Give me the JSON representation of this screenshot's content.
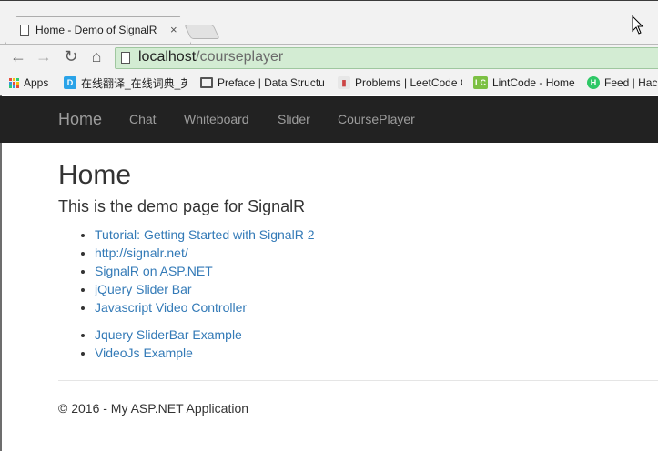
{
  "browser": {
    "tab_title": "Home - Demo of SignalR",
    "tab_close": "×",
    "url_host": "localhost",
    "url_path": "/courseplayer",
    "nav": {
      "back": "←",
      "forward": "→",
      "reload": "↻",
      "home": "⌂"
    },
    "bookmarks": [
      {
        "label": "Apps",
        "icon": "apps-grid-icon",
        "color": "#e74c3c"
      },
      {
        "label": "在线翻译_在线词典_英",
        "icon": "dict-icon",
        "color": "#2aa3e8",
        "glyph": "D"
      },
      {
        "label": "Preface | Data Structu",
        "icon": "book-icon",
        "color": "#555555"
      },
      {
        "label": "Problems | LeetCode O",
        "icon": "leetcode-icon",
        "color": "#c44"
      },
      {
        "label": "LintCode - Home",
        "icon": "lintcode-icon",
        "color": "#7cc043",
        "glyph": "LC"
      },
      {
        "label": "Feed | Hack",
        "icon": "hackerrank-icon",
        "color": "#2ec866",
        "glyph": "H"
      }
    ]
  },
  "navbar": {
    "brand": "Home",
    "links": [
      "Chat",
      "Whiteboard",
      "Slider",
      "CoursePlayer"
    ]
  },
  "main": {
    "title": "Home",
    "lead": "This is the demo page for SignalR",
    "links_group1": [
      "Tutorial: Getting Started with SignalR 2",
      "http://signalr.net/",
      "SignalR on ASP.NET",
      "jQuery Slider Bar",
      "Javascript Video Controller"
    ],
    "links_group2": [
      "Jquery SliderBar Example",
      "VideoJs Example"
    ]
  },
  "footer": {
    "text": "© 2016 - My ASP.NET Application"
  }
}
